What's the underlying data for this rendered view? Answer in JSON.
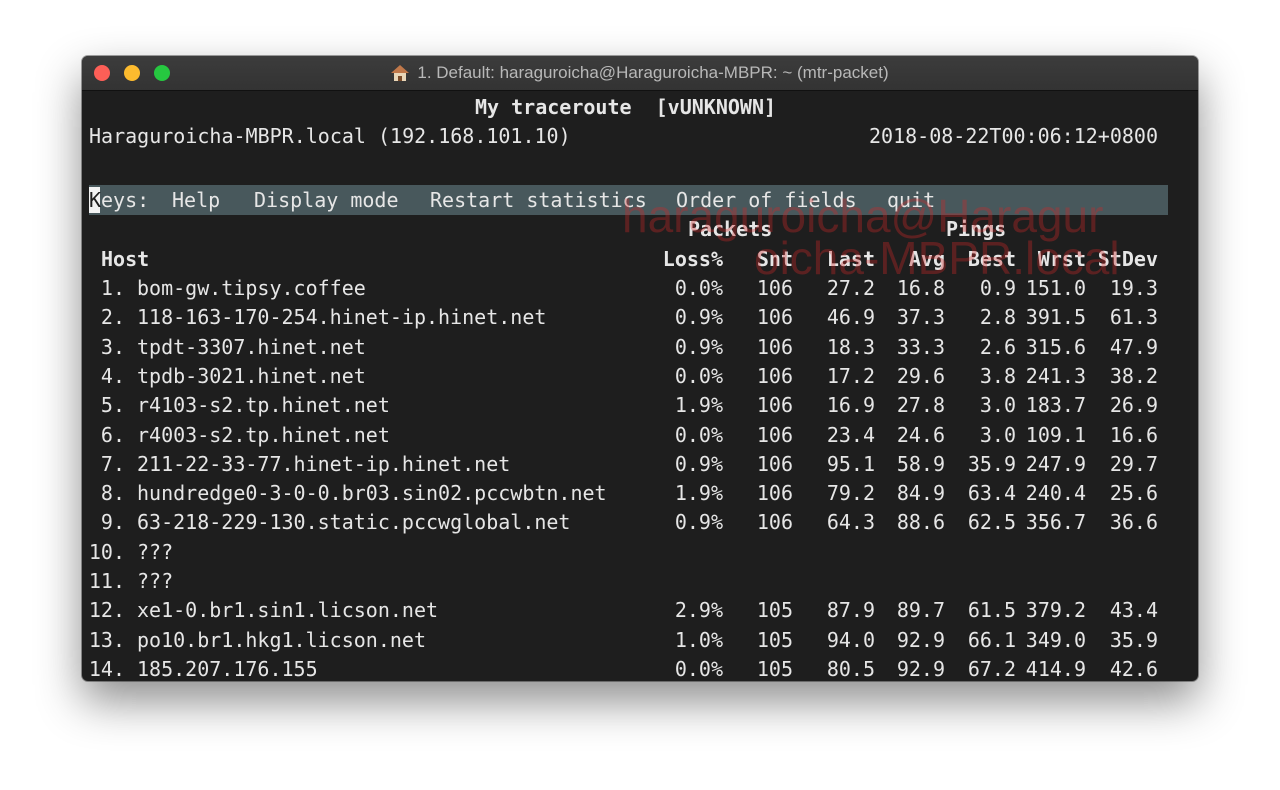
{
  "window": {
    "title": "1. Default: haraguroicha@Haraguroicha-MBPR: ~ (mtr-packet)",
    "title_icon": "home-icon"
  },
  "header": {
    "title": "My traceroute  [vUNKNOWN]",
    "host_line": "Haraguroicha-MBPR.local (192.168.101.10)",
    "timestamp": "2018-08-22T00:06:12+0800"
  },
  "keys": {
    "first_letter": "K",
    "label_rest": "eys:",
    "items": [
      "Help",
      "Display mode",
      "Restart statistics",
      "Order of fields",
      "quit"
    ]
  },
  "groups": {
    "packets": "Packets",
    "pings": "Pings"
  },
  "columns": [
    "Host",
    "Loss%",
    "Snt",
    "Last",
    "Avg",
    "Best",
    "Wrst",
    "StDev"
  ],
  "rows": [
    {
      "num": "1.",
      "host": "bom-gw.tipsy.coffee",
      "loss": "0.0%",
      "snt": "106",
      "last": "27.2",
      "avg": "16.8",
      "best": "0.9",
      "wrst": "151.0",
      "stdev": "19.3"
    },
    {
      "num": "2.",
      "host": "118-163-170-254.hinet-ip.hinet.net",
      "loss": "0.9%",
      "snt": "106",
      "last": "46.9",
      "avg": "37.3",
      "best": "2.8",
      "wrst": "391.5",
      "stdev": "61.3"
    },
    {
      "num": "3.",
      "host": "tpdt-3307.hinet.net",
      "loss": "0.9%",
      "snt": "106",
      "last": "18.3",
      "avg": "33.3",
      "best": "2.6",
      "wrst": "315.6",
      "stdev": "47.9"
    },
    {
      "num": "4.",
      "host": "tpdb-3021.hinet.net",
      "loss": "0.0%",
      "snt": "106",
      "last": "17.2",
      "avg": "29.6",
      "best": "3.8",
      "wrst": "241.3",
      "stdev": "38.2"
    },
    {
      "num": "5.",
      "host": "r4103-s2.tp.hinet.net",
      "loss": "1.9%",
      "snt": "106",
      "last": "16.9",
      "avg": "27.8",
      "best": "3.0",
      "wrst": "183.7",
      "stdev": "26.9"
    },
    {
      "num": "6.",
      "host": "r4003-s2.tp.hinet.net",
      "loss": "0.0%",
      "snt": "106",
      "last": "23.4",
      "avg": "24.6",
      "best": "3.0",
      "wrst": "109.1",
      "stdev": "16.6"
    },
    {
      "num": "7.",
      "host": "211-22-33-77.hinet-ip.hinet.net",
      "loss": "0.9%",
      "snt": "106",
      "last": "95.1",
      "avg": "58.9",
      "best": "35.9",
      "wrst": "247.9",
      "stdev": "29.7"
    },
    {
      "num": "8.",
      "host": "hundredge0-3-0-0.br03.sin02.pccwbtn.net",
      "loss": "1.9%",
      "snt": "106",
      "last": "79.2",
      "avg": "84.9",
      "best": "63.4",
      "wrst": "240.4",
      "stdev": "25.6"
    },
    {
      "num": "9.",
      "host": "63-218-229-130.static.pccwglobal.net",
      "loss": "0.9%",
      "snt": "106",
      "last": "64.3",
      "avg": "88.6",
      "best": "62.5",
      "wrst": "356.7",
      "stdev": "36.6"
    },
    {
      "num": "10.",
      "host": "???",
      "loss": "",
      "snt": "",
      "last": "",
      "avg": "",
      "best": "",
      "wrst": "",
      "stdev": ""
    },
    {
      "num": "11.",
      "host": "???",
      "loss": "",
      "snt": "",
      "last": "",
      "avg": "",
      "best": "",
      "wrst": "",
      "stdev": ""
    },
    {
      "num": "12.",
      "host": "xe1-0.br1.sin1.licson.net",
      "loss": "2.9%",
      "snt": "105",
      "last": "87.9",
      "avg": "89.7",
      "best": "61.5",
      "wrst": "379.2",
      "stdev": "43.4"
    },
    {
      "num": "13.",
      "host": "po10.br1.hkg1.licson.net",
      "loss": "1.0%",
      "snt": "105",
      "last": "94.0",
      "avg": "92.9",
      "best": "66.1",
      "wrst": "349.0",
      "stdev": "35.9"
    },
    {
      "num": "14.",
      "host": "185.207.176.155",
      "loss": "0.0%",
      "snt": "105",
      "last": "80.5",
      "avg": "92.9",
      "best": "67.2",
      "wrst": "414.9",
      "stdev": "42.6"
    }
  ],
  "watermark": {
    "line1": "haraguroicha@Haragur",
    "line2": "oicha-MBPR.local"
  }
}
